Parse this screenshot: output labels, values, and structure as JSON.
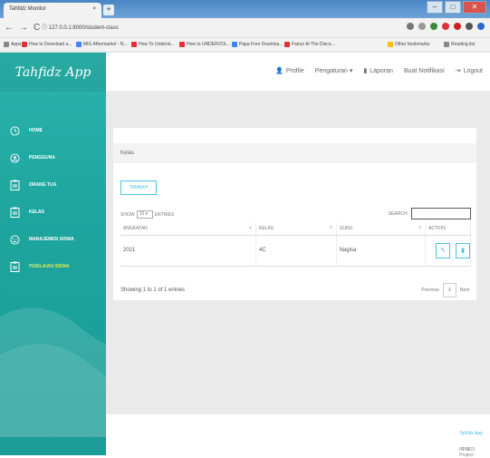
{
  "browser": {
    "tab_title": "Tahfidz Monitor",
    "tab_close": "×",
    "new_tab": "+",
    "url": "127.0.0.1:8000/student-class",
    "bookmarks": [
      {
        "label": "Apps",
        "icon": "apps-icon"
      },
      {
        "label": "How to Download a...",
        "icon": "youtube-icon"
      },
      {
        "label": "MIG Aftermarket - N...",
        "icon": "page-icon"
      },
      {
        "label": "How To Underst...",
        "icon": "youtube-icon"
      },
      {
        "label": "How to UNDERVOL...",
        "icon": "youtube-icon"
      },
      {
        "label": "Papa Free Downloa...",
        "icon": "page-icon"
      },
      {
        "label": "Fairuz At The Disco...",
        "icon": "youtube-icon"
      },
      {
        "label": "Other bookmarks",
        "icon": "folder-icon"
      },
      {
        "label": "Reading list",
        "icon": "reading-list-icon"
      }
    ]
  },
  "sidebar": {
    "logo": "Tahfidz App",
    "items": [
      {
        "label": "HOME",
        "icon": "home-icon",
        "active": false
      },
      {
        "label": "PENGGUNA",
        "icon": "user-icon",
        "active": false
      },
      {
        "label": "ORANG TUA",
        "icon": "clipboard-icon",
        "active": false
      },
      {
        "label": "KELAS",
        "icon": "clipboard-icon",
        "active": false
      },
      {
        "label": "MANAJEMEN SISWA",
        "icon": "smile-icon",
        "active": false
      },
      {
        "label": "PENILAIAN SISWA",
        "icon": "clipboard-icon",
        "active": true
      }
    ]
  },
  "topbar": {
    "profile": "Profile",
    "settings": "Pengaturan ▾",
    "report": "Laporan",
    "notification": "Buat Notifikasi",
    "logout": "Logout"
  },
  "main": {
    "card_title": "Kelas",
    "add_button": "TAMBAH",
    "show_label": "SHOW",
    "show_value": "10",
    "entries_label": "ENTRIES",
    "search_label": "SEARCH:",
    "search_value": "",
    "columns": [
      "ANGKATAN",
      "KELAS",
      "GURU",
      "ACTION"
    ],
    "rows": [
      {
        "angkatan": "2021",
        "kelas": "4C",
        "guru": "Nagisa"
      }
    ],
    "info": "Showing 1 to 1 of 1 entries",
    "prev": "Previous",
    "page": "1",
    "next": "Next"
  },
  "footer": {
    "copyright": "© 2021",
    "app_link": "Tahfidz App",
    "project": "PPSI Project"
  },
  "colors": {
    "sidebar": "#1da59e",
    "accent": "#4fc1e9",
    "active_menu": "#dde85a"
  }
}
